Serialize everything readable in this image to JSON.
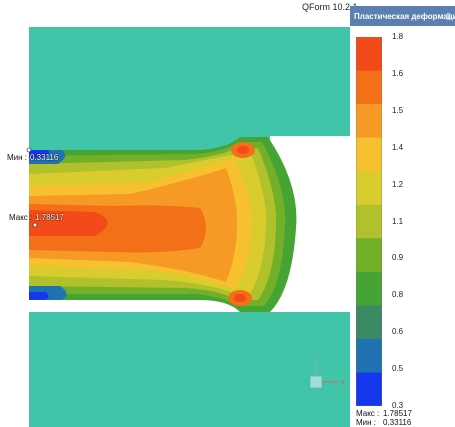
{
  "app": {
    "version": "QForm 10.2.1"
  },
  "legend": {
    "title": "Пластическая деформация",
    "pin_icon": "pin-icon",
    "ticks": [
      "1.8",
      "1.6",
      "1.5",
      "1.4",
      "1.2",
      "1.1",
      "0.9",
      "0.8",
      "0.6",
      "0.5",
      "0.3"
    ],
    "colors": [
      "#f24a18",
      "#f36f18",
      "#f69a25",
      "#f7c02e",
      "#d9cc2e",
      "#b0c12c",
      "#73b02a",
      "#46a434",
      "#3b8a63",
      "#1f73b2",
      "#1538ef"
    ],
    "max_label": "Макс :",
    "max_value": "1.78517",
    "min_label": "Мин :",
    "min_value": "0.33116"
  },
  "points": {
    "min_label": "Мин :",
    "min_value": "0.33116",
    "max_label": "Макс :",
    "max_value": "1.78517"
  },
  "axes": {
    "z": "Z",
    "x": "X"
  },
  "tool": {
    "color": "#40c5a8"
  }
}
